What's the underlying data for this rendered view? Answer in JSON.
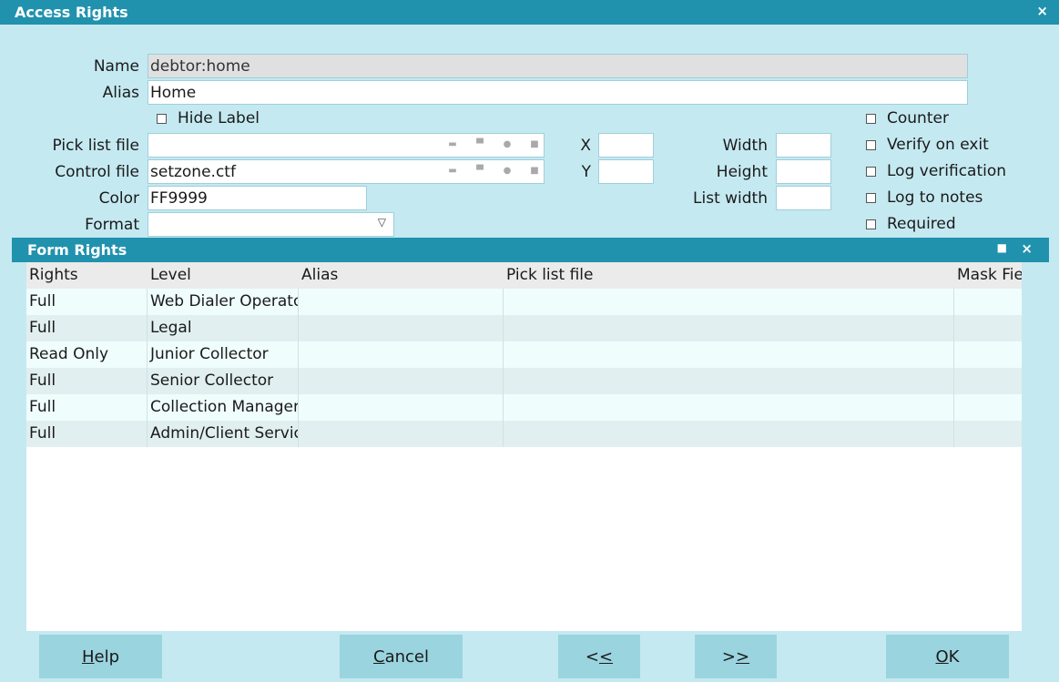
{
  "window": {
    "title": "Access Rights",
    "close_icon": "×"
  },
  "form": {
    "name_label": "Name",
    "name_value": "debtor:home",
    "alias_label": "Alias",
    "alias_value": "Home",
    "hide_label": "Hide Label",
    "picklist_label": "Pick list file",
    "picklist_value": "",
    "control_label": "Control file",
    "control_value": "setzone.ctf",
    "color_label": "Color",
    "color_value": "FF9999",
    "format_label": "Format",
    "format_value": "",
    "x_label": "X",
    "x_value": "",
    "y_label": "Y",
    "y_value": "",
    "width_label": "Width",
    "width_value": "",
    "height_label": "Height",
    "height_value": "",
    "listwidth_label": "List width",
    "listwidth_value": "",
    "counter_label": "Counter",
    "verify_label": "Verify on exit",
    "logverify_label": "Log verification",
    "lognotes_label": "Log to notes",
    "required_label": "Required"
  },
  "panel": {
    "title": "Form Rights"
  },
  "grid": {
    "headers": [
      "Rights",
      "Level",
      "Alias",
      "Pick list file",
      "Mask Fie"
    ],
    "rows": [
      [
        "Full",
        "Web Dialer Operator",
        "",
        "",
        ""
      ],
      [
        "Full",
        "Legal",
        "",
        "",
        ""
      ],
      [
        "Read Only",
        "Junior Collector",
        "",
        "",
        ""
      ],
      [
        "Full",
        "Senior Collector",
        "",
        "",
        ""
      ],
      [
        "Full",
        "Collection Manager",
        "",
        "",
        ""
      ],
      [
        "Full",
        "Admin/Client Service",
        "",
        "",
        ""
      ]
    ]
  },
  "buttons": {
    "help_accel": "H",
    "help_rest": "elp",
    "cancel_accel": "C",
    "cancel_rest": "ancel",
    "prev_first": "<",
    "prev_accel": "<",
    "next_first": ">",
    "next_accel": ">",
    "ok_accel": "O",
    "ok_rest": "K"
  }
}
